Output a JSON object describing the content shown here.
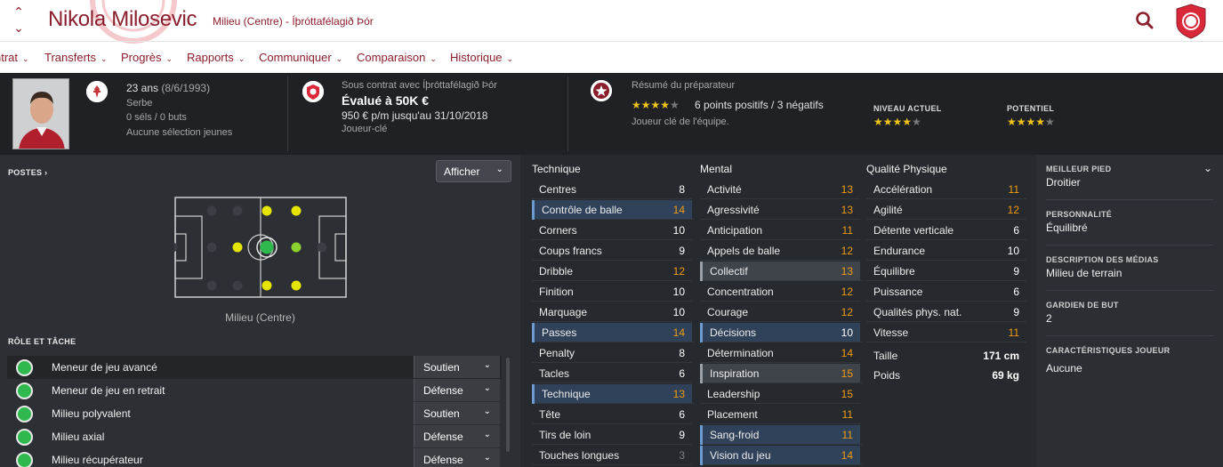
{
  "header": {
    "player_name": "Nikola Milosevic",
    "subtitle": "Milieu (Centre) - Íþróttafélagið Þór",
    "nav_up": "⌃",
    "nav_down": "⌄",
    "search_icon": "search-icon",
    "badge_text": "ÞÓR"
  },
  "menu": [
    {
      "label": "ntrat"
    },
    {
      "label": "Transferts"
    },
    {
      "label": "Progrès"
    },
    {
      "label": "Rapports"
    },
    {
      "label": "Communiquer"
    },
    {
      "label": "Comparaison"
    },
    {
      "label": "Historique"
    }
  ],
  "info": {
    "age": "23 ans",
    "birthdate": "(8/6/1993)",
    "nationality": "Serbe",
    "caps": "0 séls / 0 buts",
    "youth": "Aucune sélection jeunes",
    "contract_label": "Sous contrat avec Íþróttafélagið Þór",
    "value": "Évalué à 50K €",
    "wage": "950 € p/m jusqu'au 31/10/2018",
    "status": "Joueur-clé",
    "coach_report_label": "Résumé du préparateur",
    "coach_points": "6 points positifs / 3 négatifs",
    "coach_summary": "Joueur clé de l'équipe.",
    "coach_stars": 4,
    "current_label": "NIVEAU ACTUEL",
    "current_stars": 4,
    "potential_label": "POTENTIEL",
    "potential_stars": 4
  },
  "positions": {
    "label": "POSTES",
    "label_chev": "›",
    "display_button": "Afficher",
    "caption": "Milieu (Centre)"
  },
  "roles": {
    "label": "RÔLE ET TÂCHE",
    "items": [
      {
        "name": "Meneur de jeu avancé",
        "duty": "Soutien"
      },
      {
        "name": "Meneur de jeu en retrait",
        "duty": "Défense"
      },
      {
        "name": "Milieu polyvalent",
        "duty": "Soutien"
      },
      {
        "name": "Milieu axial",
        "duty": "Défense"
      },
      {
        "name": "Milieu récupérateur",
        "duty": "Défense"
      }
    ]
  },
  "attributes": {
    "technique": {
      "title": "Technique",
      "rows": [
        {
          "name": "Centres",
          "value": "8"
        },
        {
          "name": "Contrôle de balle",
          "value": "14"
        },
        {
          "name": "Corners",
          "value": "10"
        },
        {
          "name": "Coups francs",
          "value": "9"
        },
        {
          "name": "Dribble",
          "value": "12"
        },
        {
          "name": "Finition",
          "value": "10"
        },
        {
          "name": "Marquage",
          "value": "10"
        },
        {
          "name": "Passes",
          "value": "14"
        },
        {
          "name": "Penalty",
          "value": "8"
        },
        {
          "name": "Tacles",
          "value": "6"
        },
        {
          "name": "Technique",
          "value": "13"
        },
        {
          "name": "Tête",
          "value": "6"
        },
        {
          "name": "Tirs de loin",
          "value": "9"
        },
        {
          "name": "Touches longues",
          "value": "3"
        }
      ]
    },
    "mental": {
      "title": "Mental",
      "rows": [
        {
          "name": "Activité",
          "value": "13"
        },
        {
          "name": "Agressivité",
          "value": "13"
        },
        {
          "name": "Anticipation",
          "value": "11"
        },
        {
          "name": "Appels de balle",
          "value": "12"
        },
        {
          "name": "Collectif",
          "value": "13"
        },
        {
          "name": "Concentration",
          "value": "12"
        },
        {
          "name": "Courage",
          "value": "12"
        },
        {
          "name": "Décisions",
          "value": "10"
        },
        {
          "name": "Détermination",
          "value": "14"
        },
        {
          "name": "Inspiration",
          "value": "15"
        },
        {
          "name": "Leadership",
          "value": "15"
        },
        {
          "name": "Placement",
          "value": "11"
        },
        {
          "name": "Sang-froid",
          "value": "11"
        },
        {
          "name": "Vision du jeu",
          "value": "14"
        }
      ]
    },
    "physical": {
      "title": "Qualité Physique",
      "rows": [
        {
          "name": "Accélération",
          "value": "11"
        },
        {
          "name": "Agilité",
          "value": "12"
        },
        {
          "name": "Détente verticale",
          "value": "6"
        },
        {
          "name": "Endurance",
          "value": "10"
        },
        {
          "name": "Équilibre",
          "value": "9"
        },
        {
          "name": "Puissance",
          "value": "6"
        },
        {
          "name": "Qualités phys. nat.",
          "value": "9"
        },
        {
          "name": "Vitesse",
          "value": "11"
        }
      ],
      "height_label": "Taille",
      "height": "171 cm",
      "weight_label": "Poids",
      "weight": "69 kg"
    }
  },
  "side": {
    "best_foot_label": "MEILLEUR PIED",
    "best_foot": "Droitier",
    "personality_label": "PERSONNALITÉ",
    "personality": "Équilibré",
    "media_label": "DESCRIPTION DES MÉDIAS",
    "media": "Milieu de terrain",
    "gk_label": "GARDIEN DE BUT",
    "gk": "2",
    "traits_label": "CARACTÉRISTIQUES JOUEUR",
    "traits": "Aucune"
  },
  "colors": {
    "brand": "#8b1e2c",
    "highlight_orange": "#f39c12",
    "star": "#f0c419",
    "position_natural": "#2fb84d",
    "position_competent": "#e5e500"
  }
}
